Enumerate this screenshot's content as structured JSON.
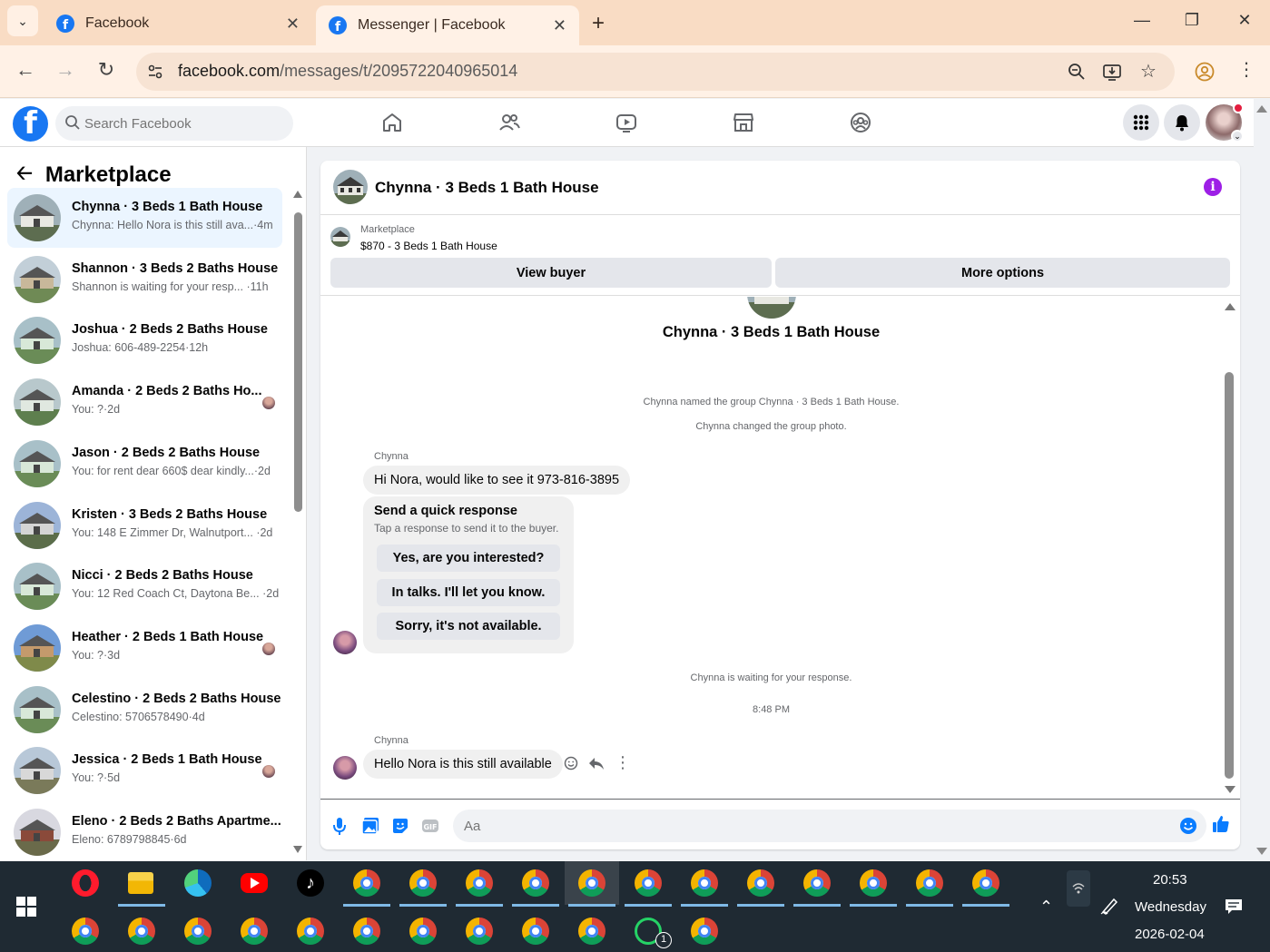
{
  "browser": {
    "tabs": [
      {
        "title": "Facebook"
      },
      {
        "title": "Messenger | Facebook"
      }
    ],
    "url_host": "facebook.com",
    "url_path": "/messages/t/2095722040965014"
  },
  "fb": {
    "search_placeholder": "Search Facebook"
  },
  "sidebar": {
    "title": "Marketplace",
    "conversations": [
      {
        "name": "Chynna · 3 Beds 1 Bath House",
        "preview": "Chynna: Hello Nora is this still ava...·4m"
      },
      {
        "name": "Shannon · 3 Beds 2 Baths House",
        "preview": "Shannon is waiting for your resp... ·11h"
      },
      {
        "name": "Joshua · 2 Beds 2 Baths House",
        "preview": "Joshua: 606-489-2254·12h"
      },
      {
        "name": "Amanda · 2 Beds 2 Baths Ho...",
        "preview": "You: ?·2d"
      },
      {
        "name": "Jason · 2 Beds 2 Baths House",
        "preview": "You: for rent dear 660$ dear kindly...·2d"
      },
      {
        "name": "Kristen · 3 Beds 2 Baths House",
        "preview": "You: 148 E Zimmer Dr, Walnutport... ·2d"
      },
      {
        "name": "Nicci · 2 Beds 2 Baths House",
        "preview": "You: 12 Red Coach Ct, Daytona Be... ·2d"
      },
      {
        "name": "Heather · 2 Beds 1 Bath House",
        "preview": "You: ?·3d"
      },
      {
        "name": "Celestino · 2 Beds 2 Baths House",
        "preview": "Celestino: 5706578490·4d"
      },
      {
        "name": "Jessica · 2 Beds 1 Bath House",
        "preview": "You: ?·5d"
      },
      {
        "name": "Eleno · 2 Beds 2 Baths Apartme...",
        "preview": "Eleno: 6789798845·6d"
      }
    ]
  },
  "chat": {
    "title": "Chynna · 3 Beds 1 Bath House",
    "marketplace_label": "Marketplace",
    "listing": "$870 - 3 Beds 1 Bath House",
    "view_buyer": "View buyer",
    "more_options": "More options",
    "group_name": "Chynna · 3 Beds 1 Bath House",
    "sys1": "Chynna named the group Chynna · 3 Beds 1 Bath House.",
    "sys2": "Chynna changed the group photo.",
    "sender1": "Chynna",
    "msg1": "Hi Nora, would like to see it 973-816-3895",
    "quick_title": "Send a quick response",
    "quick_sub": "Tap a response to send it to the buyer.",
    "quick1": "Yes, are you interested?",
    "quick2": "In talks. I'll let you know.",
    "quick3": "Sorry, it's not available.",
    "waiting": "Chynna is waiting for your response.",
    "time": "8:48 PM",
    "sender2": "Chynna",
    "msg2": "Hello Nora is this still available",
    "composer_placeholder": "Aa"
  },
  "taskbar": {
    "time": "20:53",
    "day": "Wednesday",
    "date": "2026-02-04",
    "whatsapp_badge": "1"
  }
}
